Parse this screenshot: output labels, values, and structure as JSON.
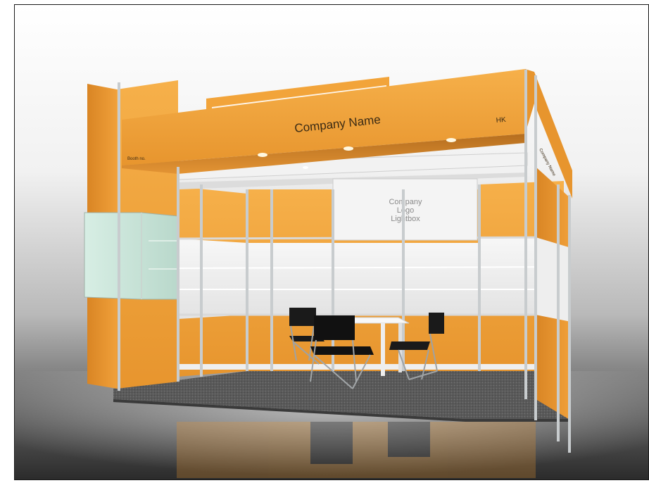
{
  "booth": {
    "fascia_title": "Company Name",
    "fascia_code": "HK",
    "booth_no_label": "Booth no.",
    "side_fascia_text": "Company Name",
    "lightbox_lines": [
      "Company",
      "Logo",
      "Lightbox"
    ]
  },
  "colors": {
    "panel_orange": "#F2A43A",
    "panel_orange_dark": "#C97A1E",
    "frame_aluminum": "#C8CCCF",
    "carpet": "#5E5E5E",
    "floor_dark": "#2B2B2B",
    "lightbox": "#F4F4F4"
  }
}
